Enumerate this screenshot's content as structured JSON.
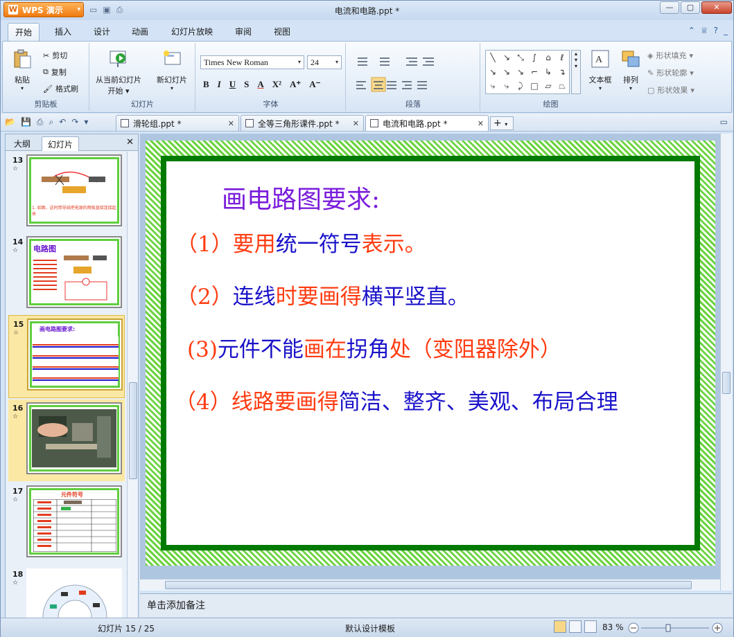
{
  "app": {
    "name": "WPS 演示",
    "window_title": "电流和电路.ppt *"
  },
  "ribbon_tabs": [
    "开始",
    "插入",
    "设计",
    "动画",
    "幻灯片放映",
    "审阅",
    "视图"
  ],
  "ribbon": {
    "clipboard": {
      "paste": "粘贴",
      "cut": "剪切",
      "copy": "复制",
      "format_painter": "格式刷",
      "label": "剪贴板"
    },
    "slides": {
      "from_current": "从当前幻灯片",
      "start": "开始",
      "new_slide": "新幻灯片",
      "label": "幻灯片"
    },
    "font": {
      "name": "Times New Roman",
      "size": "24",
      "label": "字体"
    },
    "paragraph": {
      "label": "段落"
    },
    "drawing": {
      "textbox": "文本框",
      "arrange": "排列",
      "shape_fill": "形状填充",
      "shape_outline": "形状轮廓",
      "shape_effect": "形状效果",
      "label": "绘图"
    }
  },
  "doc_tabs": [
    {
      "name": "滑轮组.ppt *"
    },
    {
      "name": "全等三角形课件.ppt *"
    },
    {
      "name": "电流和电路.ppt *"
    }
  ],
  "panel": {
    "tabs": [
      "大纲",
      "幻灯片"
    ],
    "thumbs": [
      {
        "num": "13",
        "caption": "1. 如图，这时用导线把电源的两极直接连接起来"
      },
      {
        "num": "14",
        "title": "电路图"
      },
      {
        "num": "15",
        "title": "画电路图要求:"
      },
      {
        "num": "16"
      },
      {
        "num": "17",
        "title": "元件符号"
      },
      {
        "num": "18"
      }
    ]
  },
  "slide": {
    "title": "画电路图要求:",
    "lines": [
      [
        {
          "t": "（1）要用",
          "c": "red"
        },
        {
          "t": "统一符号",
          "c": "blue"
        },
        {
          "t": "表示。",
          "c": "red"
        }
      ],
      [
        {
          "t": "（2）",
          "c": "red"
        },
        {
          "t": "连线",
          "c": "blue"
        },
        {
          "t": "时要画得",
          "c": "red"
        },
        {
          "t": "横平竖直。",
          "c": "blue"
        }
      ],
      [
        {
          "t": "(3)",
          "c": "red"
        },
        {
          "t": "元件不能",
          "c": "blue"
        },
        {
          "t": "画在",
          "c": "red"
        },
        {
          "t": "拐角",
          "c": "blue"
        },
        {
          "t": "处（变阻器除外）",
          "c": "red"
        }
      ],
      [
        {
          "t": "（4）线路要画得",
          "c": "red"
        },
        {
          "t": "简洁、整齐、美观、布局合理",
          "c": "blue"
        }
      ]
    ]
  },
  "notes_placeholder": "单击添加备注",
  "status": {
    "slide_count": "幻灯片 15 / 25",
    "template": "默认设计模板",
    "zoom": "83 %"
  }
}
